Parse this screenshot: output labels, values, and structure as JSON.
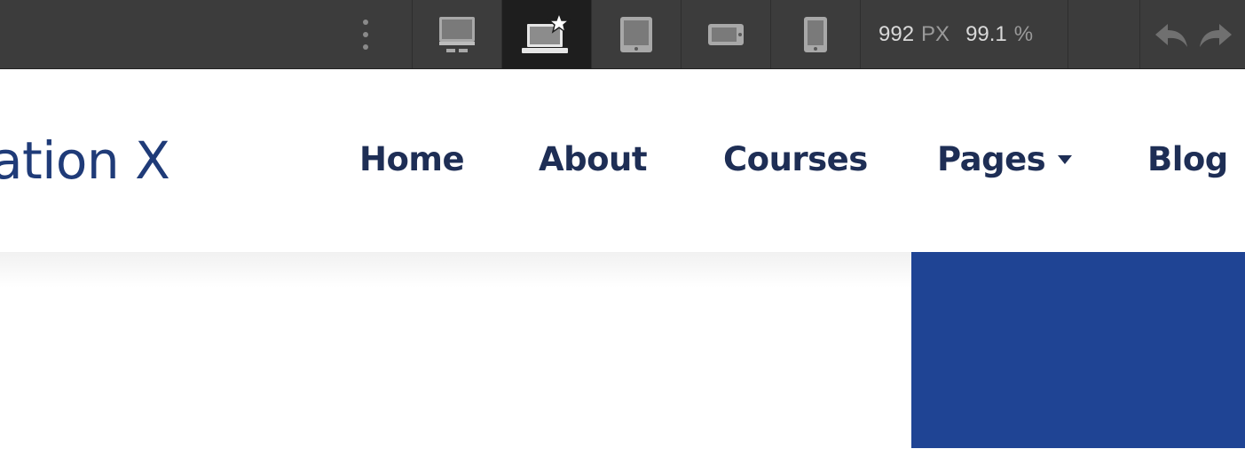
{
  "toolbar": {
    "breakpoints": [
      {
        "name": "desktop",
        "icon": "desktop-monitor-icon",
        "active": false
      },
      {
        "name": "laptop-base",
        "icon": "laptop-star-icon",
        "active": true
      },
      {
        "name": "tablet",
        "icon": "tablet-portrait-icon",
        "active": false
      },
      {
        "name": "mobile-landscape",
        "icon": "phone-landscape-icon",
        "active": false
      },
      {
        "name": "mobile-portrait",
        "icon": "phone-portrait-icon",
        "active": false
      }
    ],
    "width_value": "992",
    "width_unit": "PX",
    "zoom_value": "99.1",
    "zoom_unit": "%",
    "actions": {
      "undo_icon": "undo-arrow-icon",
      "redo_icon": "redo-arrow-icon"
    }
  },
  "site": {
    "brand_text": "ation X",
    "nav": [
      {
        "label": "Home"
      },
      {
        "label": "About"
      },
      {
        "label": "Courses"
      },
      {
        "label": "Pages",
        "has_dropdown": true
      },
      {
        "label": "Blog"
      }
    ]
  },
  "colors": {
    "toolbar_bg": "#3c3c3c",
    "toolbar_active": "#1e1e1e",
    "brand": "#1f3b78",
    "nav_text": "#1e2e55",
    "hero_accent": "#1f4494"
  }
}
